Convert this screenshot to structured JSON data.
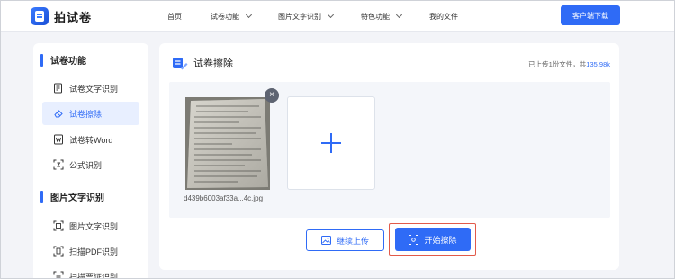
{
  "app": {
    "title": "拍试卷"
  },
  "nav": {
    "items": [
      {
        "label": "首页",
        "has_dropdown": false
      },
      {
        "label": "试卷功能",
        "has_dropdown": true
      },
      {
        "label": "图片文字识别",
        "has_dropdown": true
      },
      {
        "label": "特色功能",
        "has_dropdown": true
      },
      {
        "label": "我的文件",
        "has_dropdown": false
      }
    ],
    "download_label": "客户端下载"
  },
  "sidebar": {
    "sections": [
      {
        "title": "试卷功能",
        "items": [
          {
            "label": "试卷文字识别",
            "icon": "doc-text-icon",
            "active": false
          },
          {
            "label": "试卷擦除",
            "icon": "eraser-icon",
            "active": true
          },
          {
            "label": "试卷转Word",
            "icon": "word-doc-icon",
            "active": false
          },
          {
            "label": "公式识别",
            "icon": "formula-scan-icon",
            "active": false
          }
        ]
      },
      {
        "title": "图片文字识别",
        "items": [
          {
            "label": "图片文字识别",
            "icon": "image-text-icon",
            "active": false
          },
          {
            "label": "扫描PDF识别",
            "icon": "pdf-scan-icon",
            "active": false
          },
          {
            "label": "扫描票证识别",
            "icon": "ticket-scan-icon",
            "active": false
          }
        ]
      }
    ]
  },
  "main": {
    "title": "试卷擦除",
    "upload_status_prefix": "已上传1份文件，共",
    "upload_status_size": "135.98k",
    "file": {
      "name": "d439b6003af33a...4c.jpg"
    },
    "add_symbol": "+",
    "close_symbol": "×",
    "continue_label": "继续上传",
    "start_label": "开始擦除"
  },
  "colors": {
    "accent": "#2f6bf6",
    "active_bg": "#e8efff",
    "highlight_outline": "#e25a4a",
    "page_bg": "#f3f4f8"
  }
}
